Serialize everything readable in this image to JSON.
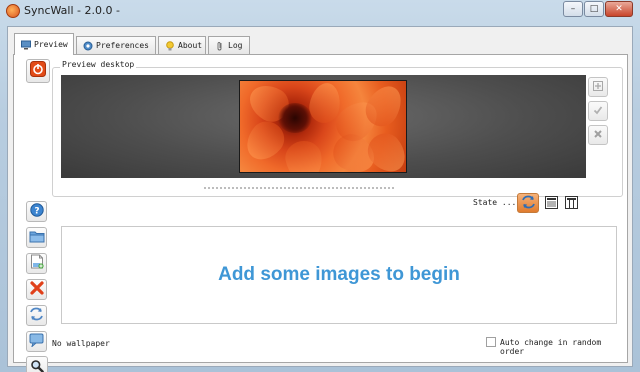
{
  "window": {
    "title": "SyncWall - 2.0.0 -",
    "minimize_glyph": "–",
    "maximize_glyph": "□",
    "close_glyph": "✕"
  },
  "tabs": [
    {
      "label": "Preview",
      "icon": "monitor-icon"
    },
    {
      "label": "Preferences",
      "icon": "gear-icon"
    },
    {
      "label": "About",
      "icon": "lightbulb-icon"
    },
    {
      "label": "Log",
      "icon": "paperclip-icon"
    }
  ],
  "preview": {
    "group_label": "Preview desktop",
    "image_subject": "orange flower",
    "side_buttons": [
      "add-icon",
      "check-icon",
      "remove-icon"
    ]
  },
  "state": {
    "label": "State ...",
    "buttons": [
      "refresh-icon",
      "single-screen-icon",
      "multi-screen-icon"
    ]
  },
  "left_buttons": [
    "power-icon",
    "help-icon",
    "folder-icon",
    "add-image-icon",
    "delete-icon",
    "sync-icon",
    "comment-icon",
    "search-icon"
  ],
  "dropzone": {
    "message": "Add some images to begin"
  },
  "status": {
    "wallpaper": "No wallpaper",
    "random_label": "Auto change in random order",
    "random_checked": false
  },
  "colors": {
    "accent_text": "#3f97d6",
    "power_button": "#e24b17",
    "delete_icon": "#e0401a"
  }
}
